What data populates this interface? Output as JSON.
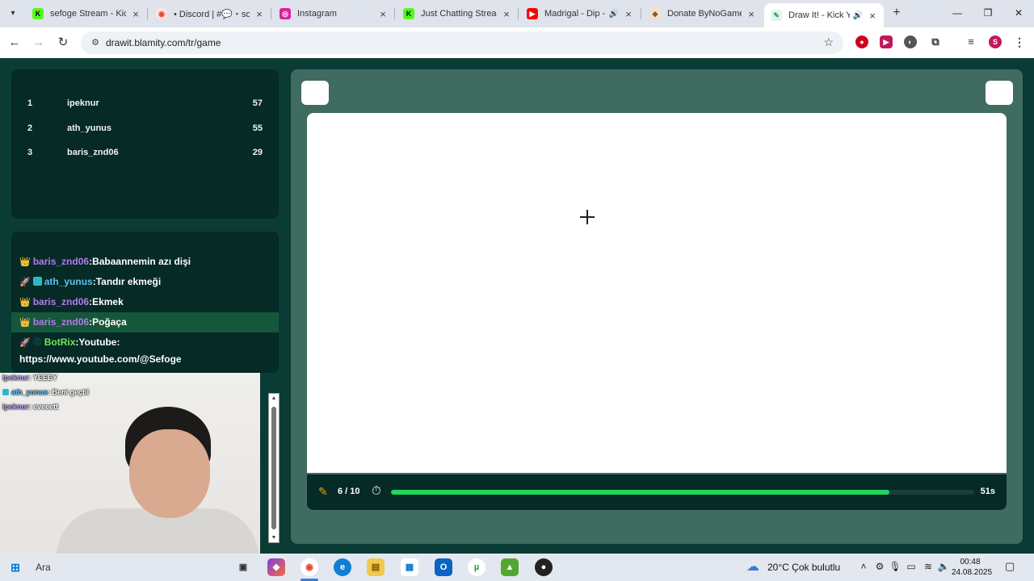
{
  "browser": {
    "tabs": [
      {
        "title": "sefoge Stream - Kick",
        "favicon": "K",
        "color": "#53fc18"
      },
      {
        "title": "• Discord | #💬・sohbet",
        "favicon": "◉",
        "color": "#ea4335"
      },
      {
        "title": "Instagram",
        "favicon": "◎",
        "color": "#d6249f"
      },
      {
        "title": "Just Chatting Streams",
        "favicon": "K",
        "color": "#53fc18"
      },
      {
        "title": "Madrigal - Dip -",
        "favicon": "▶",
        "color": "#ff0000"
      },
      {
        "title": "Donate ByNoGame -",
        "favicon": "◆",
        "color": "#8a5a2b"
      },
      {
        "title": "Draw It! - Kick Yayıncı",
        "favicon": "✎",
        "color": "#2f9e6e"
      }
    ],
    "url": "drawit.blamity.com/tr/game"
  },
  "leaderboard": [
    {
      "rank": "1",
      "name": "ipeknur",
      "score": "57"
    },
    {
      "rank": "2",
      "name": "ath_yunus",
      "score": "55"
    },
    {
      "rank": "3",
      "name": "baris_znd06",
      "score": "29"
    }
  ],
  "chat": [
    {
      "badge": "👑",
      "user": "baris_znd06",
      "text": "Babaannemin azı dişi"
    },
    {
      "badge": "🚀",
      "user": "ath_yunus",
      "text": "Tandır ekmeği"
    },
    {
      "badge": "👑",
      "user": "baris_znd06",
      "text": "Ekmek"
    },
    {
      "badge": "👑",
      "user": "baris_znd06",
      "text": "Poğaça"
    },
    {
      "badge": "🚀",
      "user": "BotRix",
      "text": "Youtube:",
      "text2": "https://www.youtube.com/@Sefoge"
    }
  ],
  "game": {
    "round": "6 / 10",
    "time_left": "51s",
    "progress_fraction": 0.855
  },
  "overlay_chat": [
    {
      "user": "ipeknur",
      "text": ": YEEEY"
    },
    {
      "user": "ath_yunus",
      "text": ": Beni geçtil"
    },
    {
      "user": "ipeknur",
      "text": ": eveeett"
    }
  ],
  "taskbar": {
    "search": "Ara",
    "weather": "20°C  Çok bulutlu",
    "time": "00:48",
    "date": "24.08.2025"
  }
}
